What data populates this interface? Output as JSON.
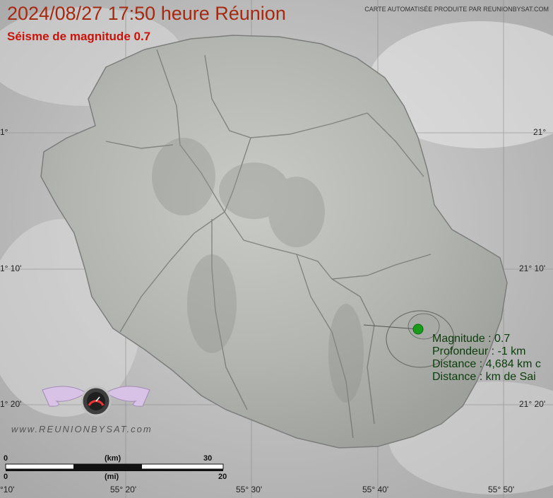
{
  "header": {
    "title": "2024/08/27 17:50 heure Réunion",
    "subtitle": "Séisme de magnitude 0.7",
    "credit": "CARTE AUTOMATISÉE PRODUITE PAR REUNIONBYSAT.COM"
  },
  "grid": {
    "lat_left": [
      "1°",
      "1° 10'",
      "1° 20'"
    ],
    "lat_right": [
      "21°",
      "21° 10'",
      "21° 20'"
    ],
    "lon_bottom": [
      "°10'",
      "55° 20'",
      "55° 30'",
      "55° 40'",
      "55° 50'"
    ]
  },
  "quake": {
    "magnitude_line": "Magnitude : 0.7",
    "depth_line": "Profondeur : -1 km",
    "distance_line": "Distance : 4,684 km c",
    "distance2_line": "Distance :  km de Sai",
    "marker_color": "#1a9a1a"
  },
  "scale": {
    "km_label": "(km)",
    "mi_label": "(mi)",
    "zero_top": "0",
    "zero_bottom": "0",
    "km_max": "30",
    "mi_max": "20"
  },
  "logo": {
    "text": "www.REUNIONBYSAT.com",
    "icon": "gauge-wings-icon"
  }
}
